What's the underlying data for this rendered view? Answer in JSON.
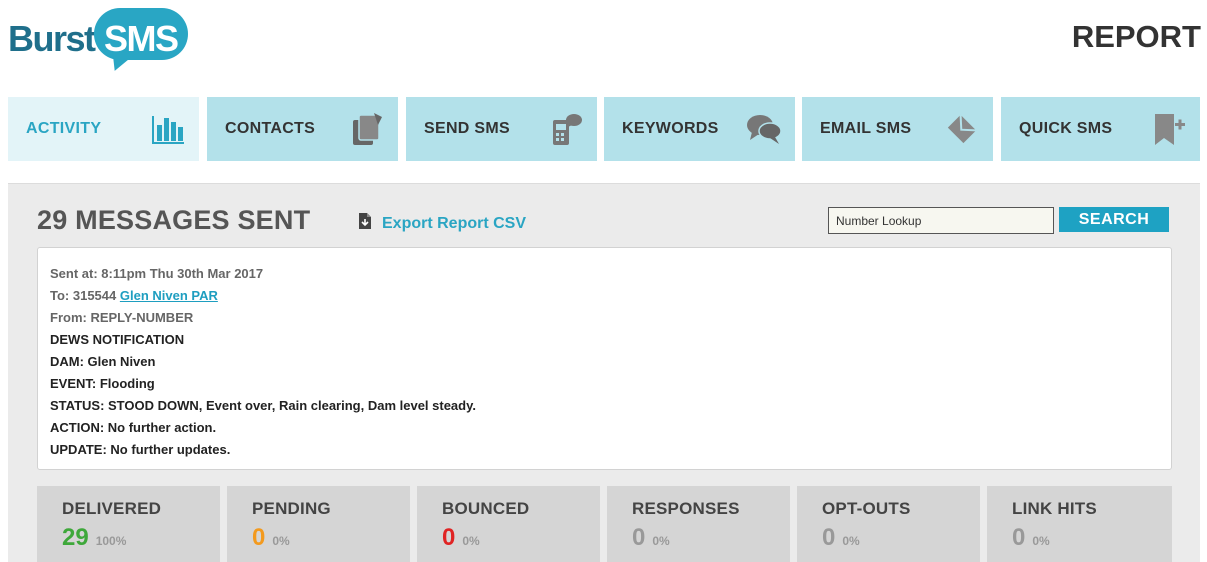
{
  "header": {
    "logo_word": "Burst",
    "logo_bubble": "SMS",
    "page_title": "REPORT"
  },
  "nav": {
    "tabs": [
      {
        "label": "ACTIVITY",
        "icon": "bar-chart-icon",
        "active": true
      },
      {
        "label": "CONTACTS",
        "icon": "contacts-icon",
        "active": false
      },
      {
        "label": "SEND SMS",
        "icon": "send-sms-icon",
        "active": false
      },
      {
        "label": "KEYWORDS",
        "icon": "speech-bubbles-icon",
        "active": false
      },
      {
        "label": "EMAIL SMS",
        "icon": "envelope-icon",
        "active": false
      },
      {
        "label": "QUICK SMS",
        "icon": "quick-add-icon",
        "active": false
      }
    ]
  },
  "report": {
    "title": "29 MESSAGES SENT",
    "export_label": "Export Report CSV",
    "lookup_placeholder": "Number Lookup",
    "search_label": "SEARCH"
  },
  "message": {
    "sent_at": "Sent at: 8:11pm Thu 30th Mar 2017",
    "to_prefix": "To: 315544 ",
    "to_link": "Glen Niven PAR",
    "from": "From: REPLY-NUMBER",
    "body": [
      "DEWS NOTIFICATION",
      "DAM: Glen Niven",
      "EVENT: Flooding",
      "STATUS: STOOD DOWN, Event over, Rain clearing, Dam level steady.",
      "ACTION: No further action.",
      "UPDATE: No further updates."
    ]
  },
  "stats": [
    {
      "label": "DELIVERED",
      "value": "29",
      "percent": "100%",
      "color": "#3ea83a"
    },
    {
      "label": "PENDING",
      "value": "0",
      "percent": "0%",
      "color": "#f39a1e"
    },
    {
      "label": "BOUNCED",
      "value": "0",
      "percent": "0%",
      "color": "#e02424"
    },
    {
      "label": "RESPONSES",
      "value": "0",
      "percent": "0%",
      "color": "#999999"
    },
    {
      "label": "OPT-OUTS",
      "value": "0",
      "percent": "0%",
      "color": "#999999"
    },
    {
      "label": "LINK HITS",
      "value": "0",
      "percent": "0%",
      "color": "#999999"
    }
  ],
  "colors": {
    "accent": "#2aa5c3",
    "tab_bg": "#b3e1ea",
    "tab_active_bg": "#e3f4f8",
    "logo_dark": "#1f6f8b"
  }
}
